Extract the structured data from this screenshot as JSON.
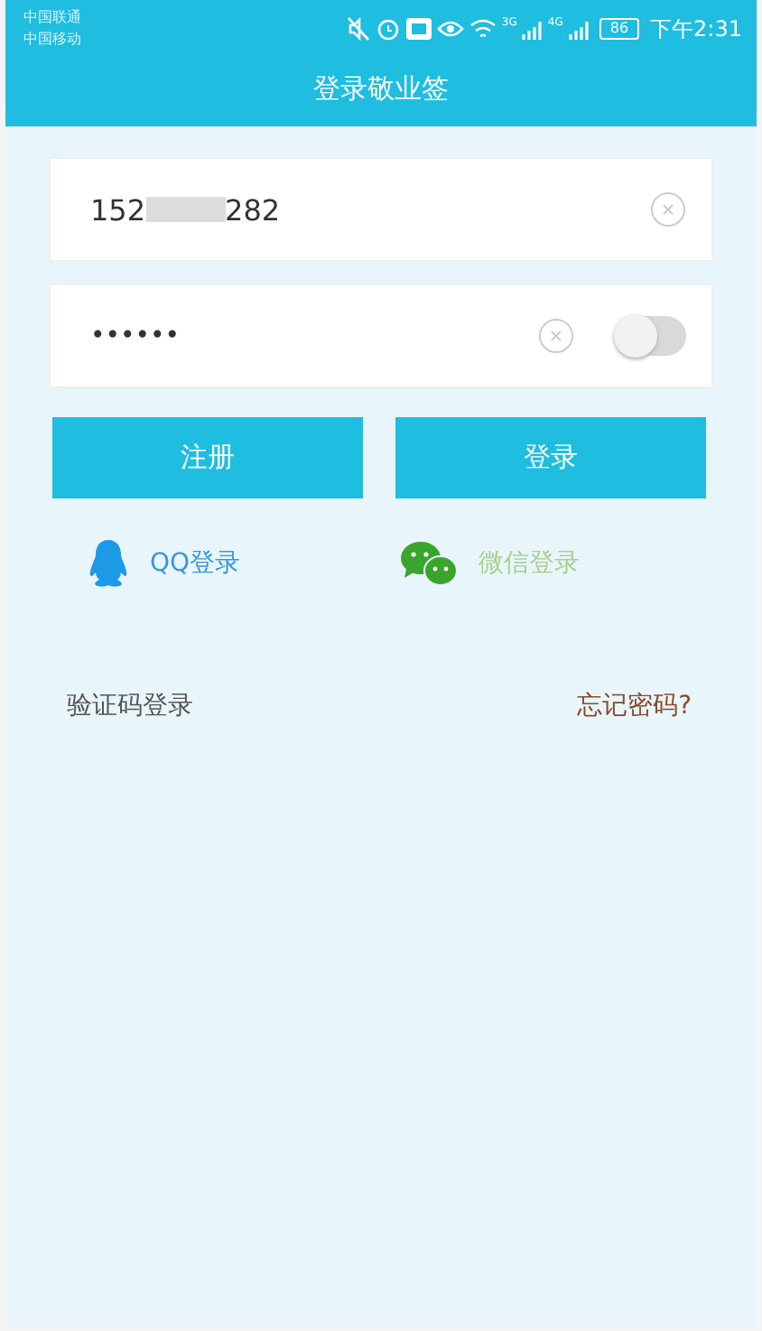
{
  "status_bar": {
    "carriers": [
      "中国联通",
      "中国移动"
    ],
    "network_labels": [
      "3G",
      "4G"
    ],
    "battery": "86",
    "time": "下午2:31"
  },
  "title": "登录敬业签",
  "account_field": {
    "value_start": "152",
    "value_end": "282",
    "redacted": true
  },
  "password_field": {
    "value": "••••••",
    "show_password": false
  },
  "buttons": [
    {
      "label": "注册",
      "kind": "register"
    },
    {
      "label": "登录",
      "kind": "login"
    }
  ],
  "social_logins": [
    {
      "label": "QQ登录",
      "kind": "qq",
      "color": "#3a97d8"
    },
    {
      "label": "微信登录",
      "kind": "wechat",
      "color": "#a9cf8e"
    }
  ],
  "sms_login": "验证码登录",
  "forgot_password": "忘记密码?"
}
